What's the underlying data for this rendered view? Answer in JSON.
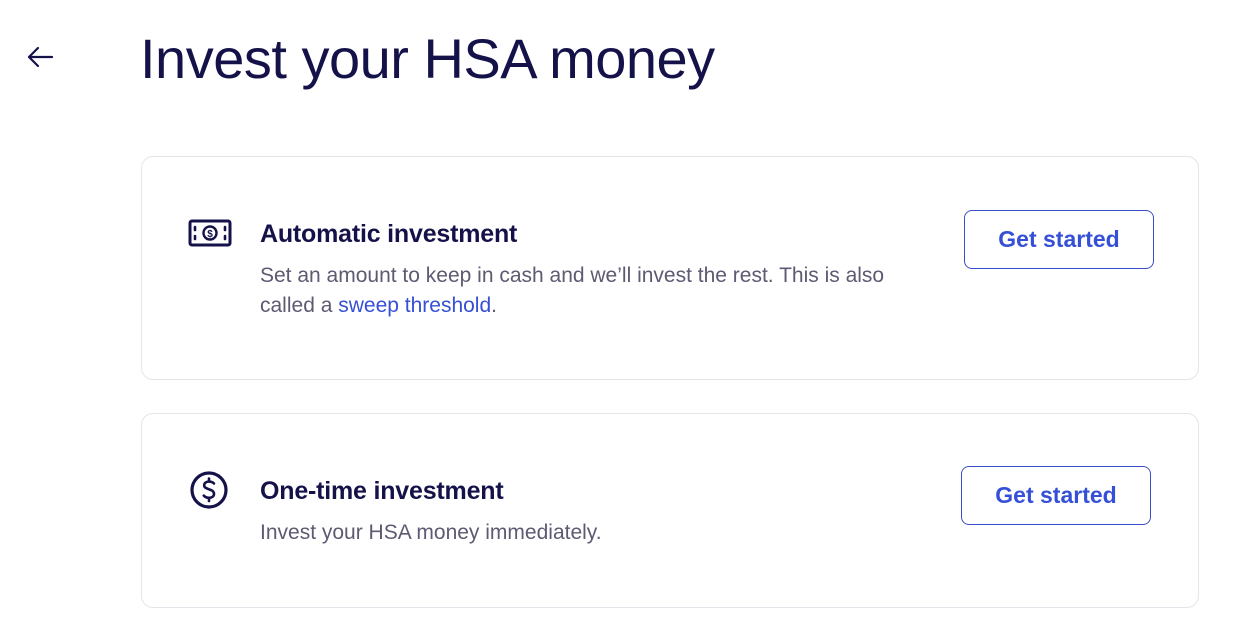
{
  "header": {
    "back_icon": "arrow-left-icon",
    "title": "Invest your HSA money"
  },
  "cards": [
    {
      "icon": "cash-bill-icon",
      "heading": "Automatic investment",
      "description_prefix": "Set an amount to keep in cash and we’ll invest the rest. This is also called a ",
      "link_text": "sweep threshold",
      "description_suffix": ".",
      "button_label": "Get started"
    },
    {
      "icon": "dollar-circle-icon",
      "heading": "One-time investment",
      "description": "Invest your HSA money immediately.",
      "button_label": "Get started"
    }
  ],
  "colors": {
    "text_primary": "#15124a",
    "text_secondary": "#5d5a72",
    "accent": "#3550d6",
    "card_border": "#e4e4ea"
  }
}
